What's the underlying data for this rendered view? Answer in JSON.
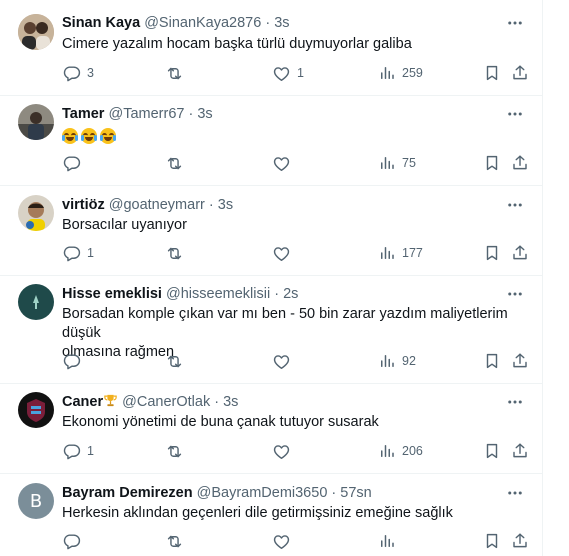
{
  "tweets": [
    {
      "name": "Sinan Kaya",
      "handle": "@SinanKaya2876",
      "separator": "·",
      "time": "3s",
      "text": "Cimere yazalım hocam başka türlü duymuyorlar galiba",
      "replies": "3",
      "retweets": "",
      "likes": "1",
      "views": "259",
      "avatar": "avatar-couple"
    },
    {
      "name": "Tamer",
      "handle": "@Tamerr67",
      "separator": "·",
      "time": "3s",
      "text": "😂😂😂",
      "replies": "",
      "retweets": "",
      "likes": "",
      "views": "75",
      "avatar": "avatar-tamer"
    },
    {
      "name": "virtiöz",
      "handle": "@goatneymarr",
      "separator": "·",
      "time": "3s",
      "text": "Borsacılar uyanıyor",
      "replies": "1",
      "retweets": "",
      "likes": "",
      "views": "177",
      "avatar": "avatar-virtioz"
    },
    {
      "name": "Hisse emeklisi",
      "handle": "@hisseemeklisii",
      "separator": "·",
      "time": "2s",
      "text_line1": "Borsadan komple çıkan var mı ben - 50 bin zarar yazdım maliyetlerim düşük",
      "text_line2": "olmasına rağmen",
      "replies": "",
      "retweets": "",
      "likes": "",
      "views": "92",
      "avatar": "avatar-teal"
    },
    {
      "name": "Caner",
      "name_badge": "trophy-icon",
      "handle": "@CanerOtlak",
      "separator": "·",
      "time": "3s",
      "text": "Ekonomi yönetimi de buna çanak tutuyor susarak",
      "replies": "1",
      "retweets": "",
      "likes": "",
      "views": "206",
      "avatar": "avatar-trabzonspor"
    },
    {
      "name": "Bayram Demirezen",
      "handle": "@BayramDemi3650",
      "separator": "·",
      "time": "57sn",
      "text": "Herkesin aklından geçenleri dile getirmişsiniz emeğine sağlık",
      "replies": "",
      "retweets": "",
      "likes": "",
      "views": "",
      "avatar": "avatar-letter-b",
      "avatar_letter": "B"
    }
  ],
  "colors": {
    "text": "#0f1419",
    "muted": "#536471",
    "border": "#eff3f4",
    "avatar_b": "#7b8e99"
  }
}
